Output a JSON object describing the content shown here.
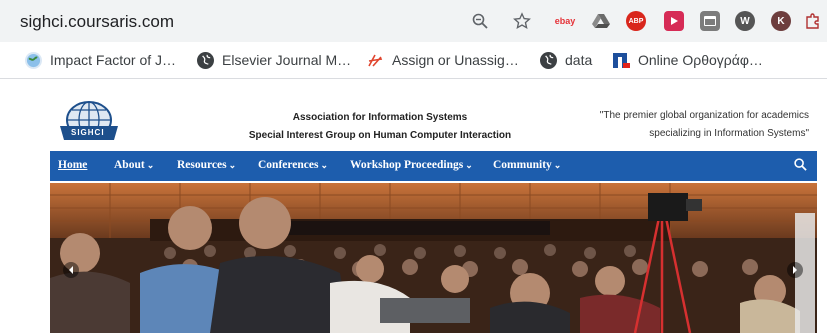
{
  "browser": {
    "url": "sighci.coursaris.com",
    "icons": [
      "zoom-icon",
      "star-icon",
      "ebay-extension",
      "drive-extension",
      "adblock-extension",
      "video-extension",
      "tab-extension",
      "wikiwand-extension",
      "profile-extension",
      "puzzle-extension"
    ],
    "ebay_label": "ebay",
    "abp_label": "ABP",
    "profile_label": "K"
  },
  "bookmarks": [
    {
      "label": "Impact Factor of J…",
      "icon": "globe-icon"
    },
    {
      "label": "Elsevier Journal M…",
      "icon": "globe-icon"
    },
    {
      "label": "Assign or Unassig…",
      "icon": "scribble-icon"
    },
    {
      "label": "data",
      "icon": "globe-icon"
    },
    {
      "label": "Online Ορθογράφ…",
      "icon": "nl-icon"
    }
  ],
  "site": {
    "logo_text": "SIGHCI",
    "assoc_line1": "Association for Information Systems",
    "assoc_line2": "Special Interest Group on Human Computer Interaction",
    "quote_line1": "\"The premier global organization for academics",
    "quote_line2": "specializing in Information Systems\""
  },
  "nav": {
    "items": [
      {
        "label": "Home"
      },
      {
        "label": "About"
      },
      {
        "label": "Resources"
      },
      {
        "label": "Conferences"
      },
      {
        "label": "Workshop Proceedings"
      },
      {
        "label": "Community"
      }
    ]
  },
  "colors": {
    "nav": "#1d5dad",
    "addr_bar": "#f1f3f4"
  }
}
